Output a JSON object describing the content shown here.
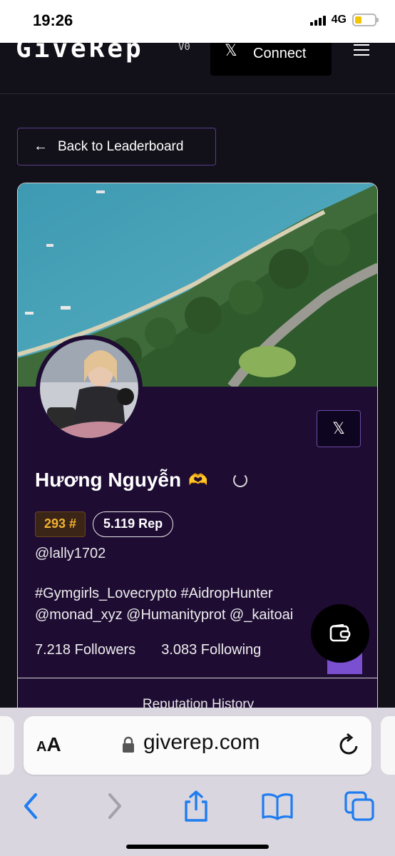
{
  "status_bar": {
    "time": "19:26",
    "network": "4G",
    "battery_level": 0.35
  },
  "header": {
    "logo": "GiveRep",
    "logo_badge": "V0",
    "connect_label": "Connect"
  },
  "back_button": {
    "label": "Back to Leaderboard"
  },
  "profile": {
    "name": "Hương Nguyễn",
    "name_emoji": "🫶",
    "rank": "293 #",
    "rep": "5.119 Rep",
    "handle": "@lally1702",
    "bio_line1": "#Gymgirls_Lovecrypto #AidropHunter",
    "bio_line2": "@monad_xyz @Humanityprot @_kaitoai",
    "followers": "7.218 Followers",
    "following": "3.083 Following"
  },
  "reputation_history": {
    "label": "Reputation History"
  },
  "browser": {
    "url": "giverep.com",
    "text_size_label_small": "A",
    "text_size_label_large": "A"
  },
  "colors": {
    "card_bg": "#1e0c33",
    "accent": "#7a4fd0",
    "rank_gold": "#f2b233",
    "ios_blue": "#1f7cf0"
  }
}
